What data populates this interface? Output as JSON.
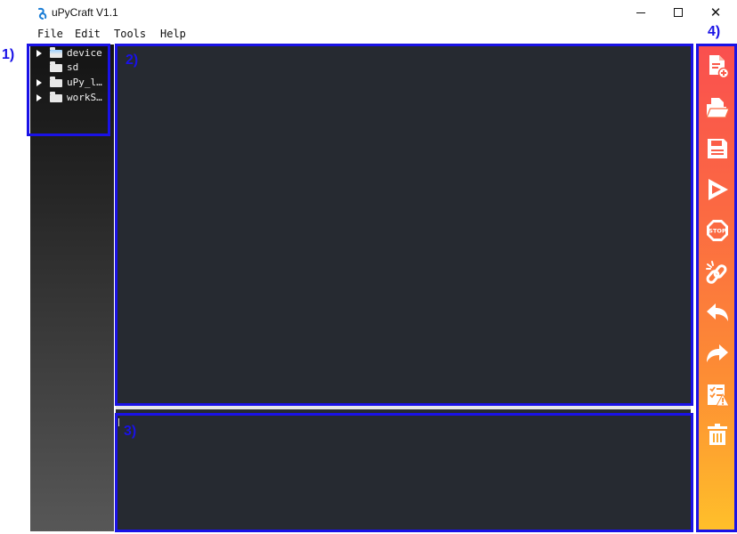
{
  "window": {
    "title": "uPyCraft V1.1",
    "controls": {
      "minimize": "minimize",
      "maximize": "maximize",
      "close": "✕"
    }
  },
  "menu": [
    "File",
    "Edit",
    "Tools",
    "Help"
  ],
  "file_tree": [
    {
      "label": "device",
      "expandable": true,
      "folder_color": "blue"
    },
    {
      "label": "sd",
      "expandable": false,
      "folder_color": "white"
    },
    {
      "label": "uPy_l…",
      "expandable": true,
      "folder_color": "white"
    },
    {
      "label": "workS…",
      "expandable": true,
      "folder_color": "white"
    }
  ],
  "toolbar": [
    "new-file-icon",
    "open-file-icon",
    "save-icon",
    "run-icon",
    "stop-icon",
    "connect-icon",
    "undo-icon",
    "redo-icon",
    "syntax-check-icon",
    "clear-icon"
  ],
  "annotations": {
    "a1": "1)",
    "a2": "2)",
    "a3": "3)",
    "a4": "4)"
  },
  "colors": {
    "editor_bg": "#262a31",
    "toolbar_top": "#fa4f4f",
    "toolbar_bottom": "#ffc02a",
    "annotation": "#1a12e6"
  }
}
